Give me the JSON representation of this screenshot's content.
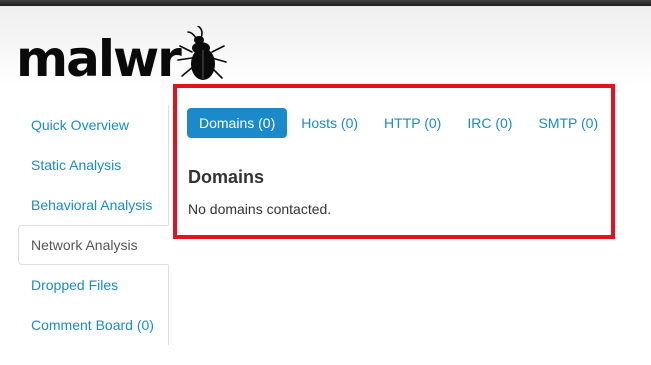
{
  "logo": {
    "text": "malwr",
    "icon": "beetle-icon"
  },
  "sidebar": {
    "items": [
      {
        "label": "Quick Overview"
      },
      {
        "label": "Static Analysis"
      },
      {
        "label": "Behavioral Analysis"
      },
      {
        "label": "Network Analysis",
        "active": true
      },
      {
        "label": "Dropped Files"
      },
      {
        "label": "Comment Board (0)"
      }
    ]
  },
  "tabs": [
    {
      "label": "Domains (0)",
      "active": true
    },
    {
      "label": "Hosts (0)"
    },
    {
      "label": "HTTP (0)"
    },
    {
      "label": "IRC (0)"
    },
    {
      "label": "SMTP (0)"
    }
  ],
  "section": {
    "title": "Domains",
    "message": "No domains contacted."
  },
  "colors": {
    "accent": "#1a8acb",
    "highlight": "#e3121f",
    "text": "#333333"
  }
}
